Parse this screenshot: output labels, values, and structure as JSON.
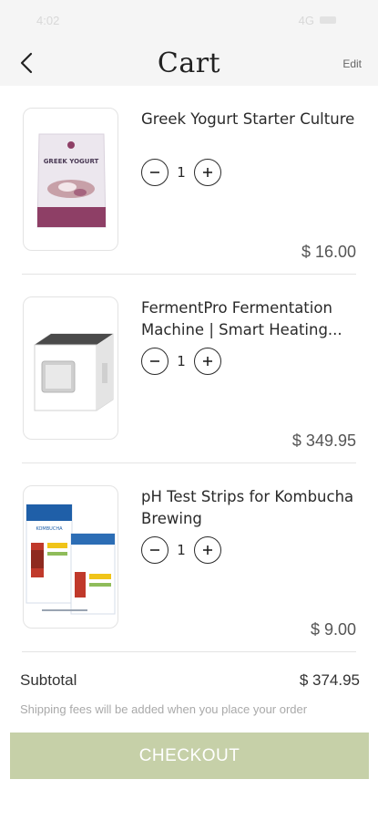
{
  "status_bar": {
    "time": "4:02",
    "network": "4G"
  },
  "header": {
    "title": "Cart",
    "edit_label": "Edit",
    "back_icon": "chevron-left-icon"
  },
  "items": [
    {
      "name": "Greek Yogurt Starter Culture",
      "quantity": "1",
      "price": "$ 16.00",
      "image_label": "GREEK YOGURT"
    },
    {
      "name": "FermentPro Fermentation Machine | Smart Heating...",
      "quantity": "1",
      "price": "$ 349.95"
    },
    {
      "name": "pH Test Strips for Kombucha Brewing",
      "quantity": "1",
      "price": "$ 9.00",
      "image_label": "KOMBUCHA"
    }
  ],
  "summary": {
    "subtotal_label": "Subtotal",
    "subtotal_value": "$ 374.95",
    "shipping_note": "Shipping fees will be added when you place your order"
  },
  "checkout": {
    "label": "CHECKOUT",
    "color": "#c6d0a8"
  }
}
